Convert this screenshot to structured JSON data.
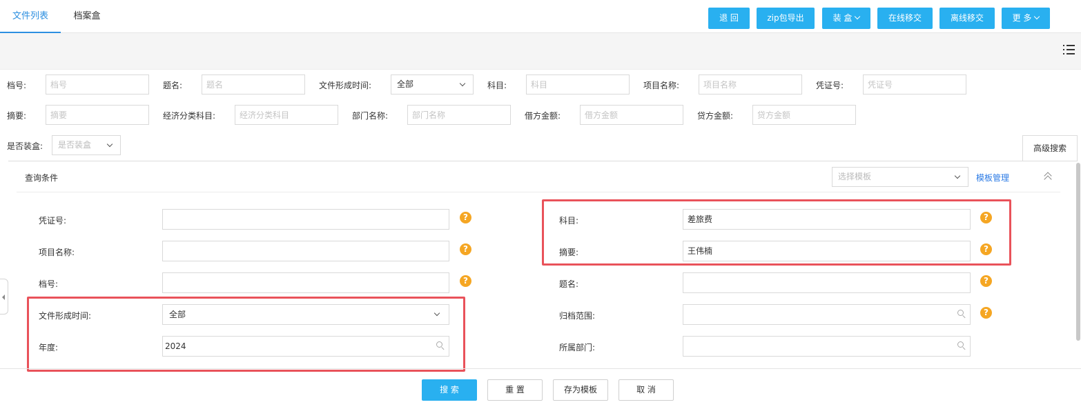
{
  "tabs": [
    {
      "label": "文件列表",
      "active": true
    },
    {
      "label": "档案盒",
      "active": false
    }
  ],
  "toolbar": {
    "back": "退 回",
    "zip_export": "zip包导出",
    "box": "装 盒",
    "online_transfer": "在线移交",
    "offline_transfer": "离线移交",
    "more": "更 多"
  },
  "filters": {
    "archive_no": {
      "label": "档号:",
      "placeholder": "档号"
    },
    "title": {
      "label": "题名:",
      "placeholder": "题名"
    },
    "form_time": {
      "label": "文件形成时间:",
      "value": "全部"
    },
    "subject": {
      "label": "科目:",
      "placeholder": "科目"
    },
    "project_name": {
      "label": "项目名称:",
      "placeholder": "项目名称"
    },
    "voucher_no": {
      "label": "凭证号:",
      "placeholder": "凭证号"
    },
    "summary": {
      "label": "摘要:",
      "placeholder": "摘要"
    },
    "econ_subject": {
      "label": "经济分类科目:",
      "placeholder": "经济分类科目"
    },
    "dept_name": {
      "label": "部门名称:",
      "placeholder": "部门名称"
    },
    "debit": {
      "label": "借方金额:",
      "placeholder": "借方金额"
    },
    "credit": {
      "label": "贷方金额:",
      "placeholder": "贷方金额"
    },
    "boxed": {
      "label": "是否装盒:",
      "placeholder": "是否装盒"
    }
  },
  "advanced_tab": "高级搜索",
  "advanced": {
    "query_condition": "查询条件",
    "template_placeholder": "选择模板",
    "template_manage": "模板管理",
    "left": {
      "voucher_no": {
        "label": "凭证号:",
        "value": ""
      },
      "project_name": {
        "label": "项目名称:",
        "value": ""
      },
      "archive_no": {
        "label": "档号:",
        "value": ""
      },
      "form_time": {
        "label": "文件形成时间:",
        "value": "全部"
      },
      "year": {
        "label": "年度:",
        "value": "2024"
      }
    },
    "right": {
      "subject": {
        "label": "科目:",
        "value": "差旅费"
      },
      "summary": {
        "label": "摘要:",
        "value": "王伟楠"
      },
      "title": {
        "label": "题名:",
        "value": ""
      },
      "archive_scope": {
        "label": "归档范围:",
        "value": ""
      },
      "department": {
        "label": "所属部门:",
        "value": ""
      }
    },
    "help_glyph": "?"
  },
  "footer": {
    "search": "搜 索",
    "reset": "重 置",
    "save_template": "存为模板",
    "cancel": "取 消"
  },
  "colors": {
    "accent": "#29b0f0",
    "highlight": "#e9525a",
    "help": "#f5a623",
    "link": "#2c7be5"
  }
}
